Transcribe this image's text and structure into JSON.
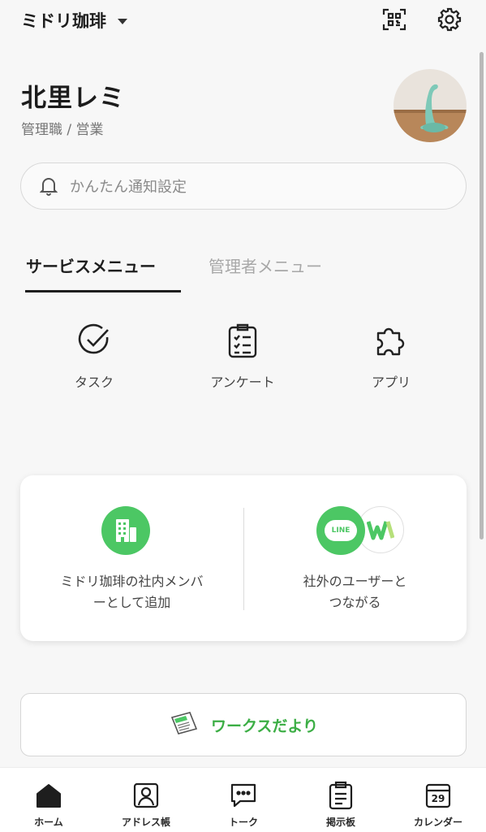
{
  "header": {
    "org_name": "ミドリ珈琲",
    "icons": [
      "qr-code-icon",
      "gear-icon"
    ]
  },
  "profile": {
    "name": "北里レミ",
    "role": "管理職 / 営業"
  },
  "notify": {
    "label": "かんたん通知設定",
    "icon": "bell-icon"
  },
  "tabs": [
    {
      "label": "サービスメニュー",
      "active": true
    },
    {
      "label": "管理者メニュー",
      "active": false
    }
  ],
  "services": [
    {
      "label": "タスク",
      "icon": "check-circle-icon"
    },
    {
      "label": "アンケート",
      "icon": "clipboard-icon"
    },
    {
      "label": "アプリ",
      "icon": "puzzle-icon"
    }
  ],
  "invite_card": {
    "internal": {
      "line1": "ミドリ珈琲の社内メンバ",
      "line2": "ーとして追加",
      "icon": "building-icon"
    },
    "external": {
      "line1": "社外のユーザーと",
      "line2": "つながる",
      "badge_text": "LINE",
      "icons": [
        "line-icon",
        "works-icon"
      ]
    }
  },
  "works_link": {
    "label": "ワークスだより",
    "icon": "newspaper-icon"
  },
  "bottom_nav": [
    {
      "label": "ホーム",
      "icon": "home-icon",
      "active": true
    },
    {
      "label": "アドレス帳",
      "icon": "address-book-icon"
    },
    {
      "label": "トーク",
      "icon": "chat-icon"
    },
    {
      "label": "掲示板",
      "icon": "board-icon"
    },
    {
      "label": "カレンダー",
      "icon": "calendar-icon",
      "day": "29"
    }
  ],
  "colors": {
    "accent_green": "#3cae45",
    "line_green": "#4cc764",
    "text_primary": "#1e1e1e",
    "text_secondary": "#757575"
  }
}
